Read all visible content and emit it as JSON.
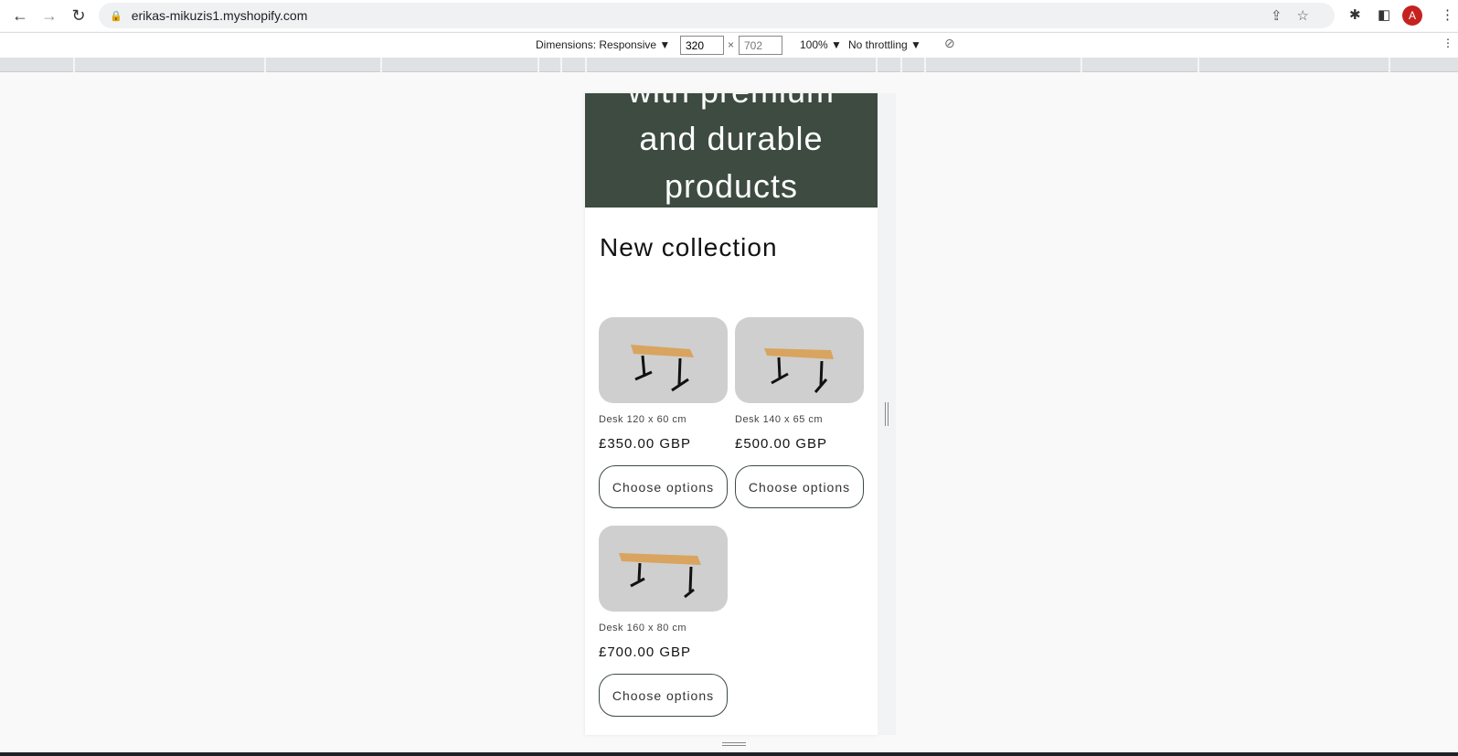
{
  "browser": {
    "url": "erikas-mikuzis1.myshopify.com",
    "avatar_letter": "A"
  },
  "devtools": {
    "dimensions_label": "Dimensions: Responsive ▼",
    "width": "320",
    "times": "×",
    "height": "702",
    "zoom": "100% ▼",
    "throttling": "No throttling ▼"
  },
  "hero": {
    "lines": [
      "with premium",
      "and durable",
      "products"
    ]
  },
  "collection": {
    "heading": "New collection",
    "products": [
      {
        "title": "Desk 120 x 60 cm",
        "price": "£350.00 GBP",
        "button": "Choose options"
      },
      {
        "title": "Desk 140 x 65 cm",
        "price": "£500.00 GBP",
        "button": "Choose options"
      },
      {
        "title": "Desk 160 x 80 cm",
        "price": "£700.00 GBP",
        "button": "Choose options"
      }
    ]
  },
  "colors": {
    "hero_bg": "#3d4b41",
    "card_bg": "#cfcfcf"
  }
}
